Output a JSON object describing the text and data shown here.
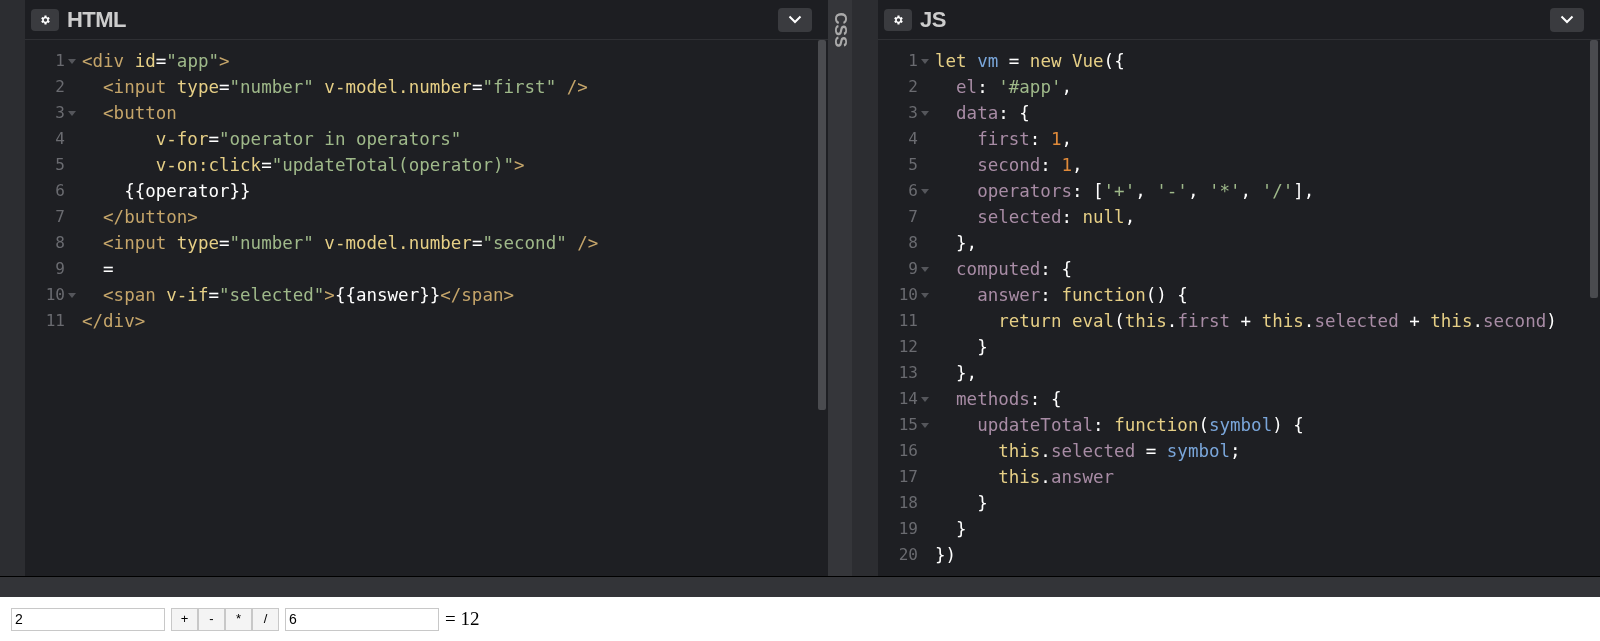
{
  "panels": [
    {
      "title": "HTML",
      "lines": [
        {
          "number": "1",
          "fold": true,
          "tokens": [
            {
              "kind": "tag",
              "text": "<div "
            },
            {
              "kind": "attr",
              "text": "id"
            },
            {
              "kind": "punct",
              "text": "="
            },
            {
              "kind": "str",
              "text": "\"app\""
            },
            {
              "kind": "tag",
              "text": ">"
            }
          ]
        },
        {
          "number": "2",
          "fold": false,
          "tokens": [
            {
              "kind": "tag",
              "text": "  <input "
            },
            {
              "kind": "attr",
              "text": "type"
            },
            {
              "kind": "punct",
              "text": "="
            },
            {
              "kind": "str",
              "text": "\"number\" "
            },
            {
              "kind": "attr",
              "text": "v-model.number"
            },
            {
              "kind": "punct",
              "text": "="
            },
            {
              "kind": "str",
              "text": "\"first\""
            },
            {
              "kind": "tag",
              "text": " />"
            }
          ]
        },
        {
          "number": "3",
          "fold": true,
          "tokens": [
            {
              "kind": "tag",
              "text": "  <button"
            }
          ]
        },
        {
          "number": "4",
          "fold": false,
          "tokens": [
            {
              "kind": "attr",
              "text": "       v-for"
            },
            {
              "kind": "punct",
              "text": "="
            },
            {
              "kind": "str",
              "text": "\"operator in operators\""
            }
          ]
        },
        {
          "number": "5",
          "fold": false,
          "tokens": [
            {
              "kind": "attr",
              "text": "       v-on:click"
            },
            {
              "kind": "punct",
              "text": "="
            },
            {
              "kind": "str",
              "text": "\"updateTotal(operator)\""
            },
            {
              "kind": "tag",
              "text": ">"
            }
          ]
        },
        {
          "number": "6",
          "fold": false,
          "tokens": [
            {
              "kind": "text",
              "text": "    {{operator}}"
            }
          ]
        },
        {
          "number": "7",
          "fold": false,
          "tokens": [
            {
              "kind": "tag",
              "text": "  </button>"
            }
          ]
        },
        {
          "number": "8",
          "fold": false,
          "tokens": [
            {
              "kind": "tag",
              "text": "  <input "
            },
            {
              "kind": "attr",
              "text": "type"
            },
            {
              "kind": "punct",
              "text": "="
            },
            {
              "kind": "str",
              "text": "\"number\" "
            },
            {
              "kind": "attr",
              "text": "v-model.number"
            },
            {
              "kind": "punct",
              "text": "="
            },
            {
              "kind": "str",
              "text": "\"second\""
            },
            {
              "kind": "tag",
              "text": " />"
            }
          ]
        },
        {
          "number": "9",
          "fold": false,
          "tokens": [
            {
              "kind": "text",
              "text": "  ="
            }
          ]
        },
        {
          "number": "10",
          "fold": true,
          "tokens": [
            {
              "kind": "tag",
              "text": "  <span "
            },
            {
              "kind": "attr",
              "text": "v-if"
            },
            {
              "kind": "punct",
              "text": "="
            },
            {
              "kind": "str",
              "text": "\"selected\""
            },
            {
              "kind": "tag",
              "text": ">"
            },
            {
              "kind": "text",
              "text": "{{answer}}"
            },
            {
              "kind": "tag",
              "text": "</span>"
            }
          ]
        },
        {
          "number": "11",
          "fold": false,
          "tokens": [
            {
              "kind": "tag",
              "text": "</div>"
            }
          ]
        }
      ]
    },
    {
      "title": "JS",
      "lines": [
        {
          "number": "1",
          "fold": true,
          "tokens": [
            {
              "kind": "kw",
              "text": "let "
            },
            {
              "kind": "var",
              "text": "vm"
            },
            {
              "kind": "punct",
              "text": " = "
            },
            {
              "kind": "kw",
              "text": "new Vue"
            },
            {
              "kind": "punct",
              "text": "({"
            }
          ]
        },
        {
          "number": "2",
          "fold": false,
          "tokens": [
            {
              "kind": "prop",
              "text": "  el"
            },
            {
              "kind": "punct",
              "text": ": "
            },
            {
              "kind": "str",
              "text": "'#app'"
            },
            {
              "kind": "punct",
              "text": ","
            }
          ]
        },
        {
          "number": "3",
          "fold": true,
          "tokens": [
            {
              "kind": "prop",
              "text": "  data"
            },
            {
              "kind": "punct",
              "text": ": {"
            }
          ]
        },
        {
          "number": "4",
          "fold": false,
          "tokens": [
            {
              "kind": "prop",
              "text": "    first"
            },
            {
              "kind": "punct",
              "text": ": "
            },
            {
              "kind": "num",
              "text": "1"
            },
            {
              "kind": "punct",
              "text": ","
            }
          ]
        },
        {
          "number": "5",
          "fold": false,
          "tokens": [
            {
              "kind": "prop",
              "text": "    second"
            },
            {
              "kind": "punct",
              "text": ": "
            },
            {
              "kind": "num",
              "text": "1"
            },
            {
              "kind": "punct",
              "text": ","
            }
          ]
        },
        {
          "number": "6",
          "fold": true,
          "tokens": [
            {
              "kind": "prop",
              "text": "    operators"
            },
            {
              "kind": "punct",
              "text": ": ["
            },
            {
              "kind": "str",
              "text": "'+'"
            },
            {
              "kind": "punct",
              "text": ", "
            },
            {
              "kind": "str",
              "text": "'-'"
            },
            {
              "kind": "punct",
              "text": ", "
            },
            {
              "kind": "str",
              "text": "'*'"
            },
            {
              "kind": "punct",
              "text": ", "
            },
            {
              "kind": "str",
              "text": "'/'"
            },
            {
              "kind": "punct",
              "text": "],"
            }
          ]
        },
        {
          "number": "7",
          "fold": false,
          "tokens": [
            {
              "kind": "prop",
              "text": "    selected"
            },
            {
              "kind": "punct",
              "text": ": "
            },
            {
              "kind": "kw",
              "text": "null"
            },
            {
              "kind": "punct",
              "text": ","
            }
          ]
        },
        {
          "number": "8",
          "fold": false,
          "tokens": [
            {
              "kind": "punct",
              "text": "  },"
            }
          ]
        },
        {
          "number": "9",
          "fold": true,
          "tokens": [
            {
              "kind": "prop",
              "text": "  computed"
            },
            {
              "kind": "punct",
              "text": ": {"
            }
          ]
        },
        {
          "number": "10",
          "fold": true,
          "tokens": [
            {
              "kind": "prop",
              "text": "    answer"
            },
            {
              "kind": "punct",
              "text": ": "
            },
            {
              "kind": "kw",
              "text": "function"
            },
            {
              "kind": "punct",
              "text": "() {"
            }
          ]
        },
        {
          "number": "11",
          "fold": false,
          "tokens": [
            {
              "kind": "kw",
              "text": "      return eval"
            },
            {
              "kind": "punct",
              "text": "("
            },
            {
              "kind": "kw",
              "text": "this"
            },
            {
              "kind": "punct",
              "text": "."
            },
            {
              "kind": "prop",
              "text": "first"
            },
            {
              "kind": "punct",
              "text": " + "
            },
            {
              "kind": "kw",
              "text": "this"
            },
            {
              "kind": "punct",
              "text": "."
            },
            {
              "kind": "prop",
              "text": "selected"
            },
            {
              "kind": "punct",
              "text": " + "
            },
            {
              "kind": "kw",
              "text": "this"
            },
            {
              "kind": "punct",
              "text": "."
            },
            {
              "kind": "prop",
              "text": "second"
            },
            {
              "kind": "punct",
              "text": ")"
            }
          ]
        },
        {
          "number": "12",
          "fold": false,
          "tokens": [
            {
              "kind": "punct",
              "text": "    }"
            }
          ]
        },
        {
          "number": "13",
          "fold": false,
          "tokens": [
            {
              "kind": "punct",
              "text": "  },"
            }
          ]
        },
        {
          "number": "14",
          "fold": true,
          "tokens": [
            {
              "kind": "prop",
              "text": "  methods"
            },
            {
              "kind": "punct",
              "text": ": {"
            }
          ]
        },
        {
          "number": "15",
          "fold": true,
          "tokens": [
            {
              "kind": "prop",
              "text": "    updateTotal"
            },
            {
              "kind": "punct",
              "text": ": "
            },
            {
              "kind": "kw",
              "text": "function"
            },
            {
              "kind": "punct",
              "text": "("
            },
            {
              "kind": "var",
              "text": "symbol"
            },
            {
              "kind": "punct",
              "text": ") {"
            }
          ]
        },
        {
          "number": "16",
          "fold": false,
          "tokens": [
            {
              "kind": "kw",
              "text": "      this"
            },
            {
              "kind": "punct",
              "text": "."
            },
            {
              "kind": "prop",
              "text": "selected"
            },
            {
              "kind": "punct",
              "text": " = "
            },
            {
              "kind": "var",
              "text": "symbol"
            },
            {
              "kind": "punct",
              "text": ";"
            }
          ]
        },
        {
          "number": "17",
          "fold": false,
          "tokens": [
            {
              "kind": "kw",
              "text": "      this"
            },
            {
              "kind": "punct",
              "text": "."
            },
            {
              "kind": "prop",
              "text": "answer"
            }
          ]
        },
        {
          "number": "18",
          "fold": false,
          "tokens": [
            {
              "kind": "punct",
              "text": "    }"
            }
          ]
        },
        {
          "number": "19",
          "fold": false,
          "tokens": [
            {
              "kind": "punct",
              "text": "  }"
            }
          ]
        },
        {
          "number": "20",
          "fold": false,
          "tokens": [
            {
              "kind": "punct",
              "text": "})"
            }
          ]
        }
      ]
    }
  ],
  "collapsed_panel": {
    "title": "CSS"
  },
  "preview": {
    "first_input": "2",
    "operator_buttons": [
      "+",
      "-",
      "*",
      "/"
    ],
    "second_input": "6",
    "result": "= 12"
  }
}
